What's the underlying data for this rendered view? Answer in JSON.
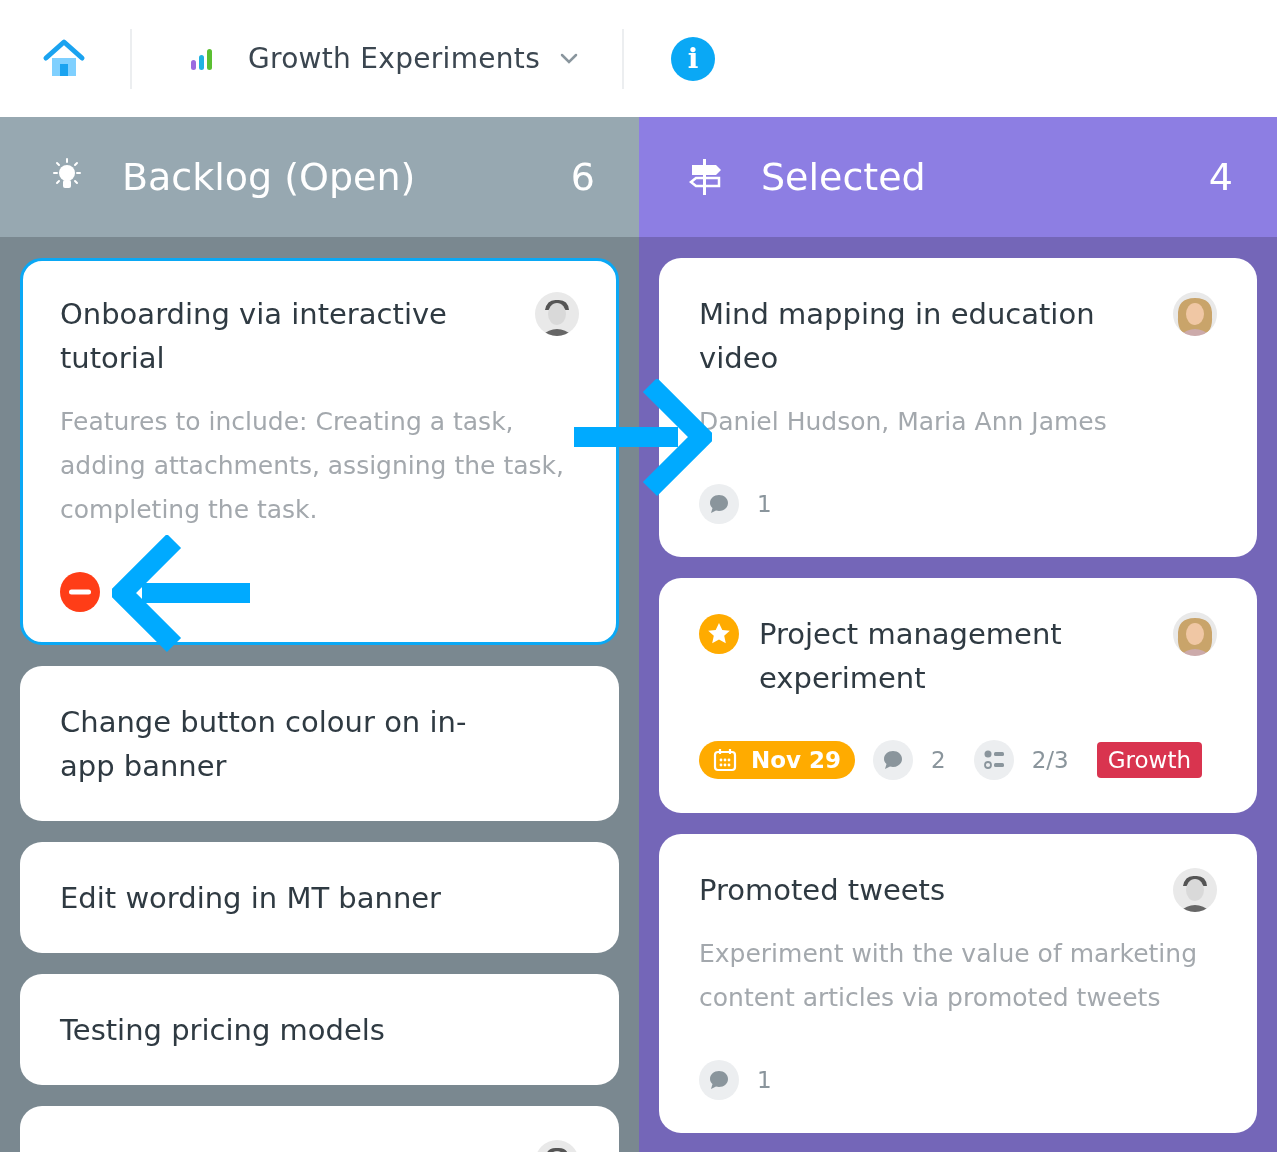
{
  "header": {
    "project": "Growth Experiments",
    "info": "i"
  },
  "columns": [
    {
      "title": "Backlog (Open)",
      "count": "6",
      "kind": "backlog",
      "cards": [
        {
          "title": "Onboarding via interactive tutorial",
          "selected": true,
          "avatar": {
            "kind": "man"
          },
          "description": "Features to include: Creating a task, adding attachments, assigning the task, completing the task.",
          "blocked": true
        },
        {
          "title": "Change button colour on in-app banner",
          "selected": false
        },
        {
          "title": "Edit wording in MT banner",
          "selected": false
        },
        {
          "title": "Testing pricing models",
          "selected": false
        },
        {
          "selected": false,
          "avatar": {
            "kind": "man"
          }
        }
      ]
    },
    {
      "title": "Selected",
      "count": "4",
      "kind": "selected",
      "cards": [
        {
          "title": "Mind mapping in education video",
          "selected": false,
          "avatar": {
            "kind": "woman"
          },
          "description": "Daniel Hudson, Maria Ann James",
          "comments": "1"
        },
        {
          "title": "Project management experiment",
          "selected": false,
          "avatar": {
            "kind": "woman"
          },
          "starred": true,
          "due": "Nov 29",
          "comments": "2",
          "checklist": "2/3",
          "tag": {
            "label": "Growth",
            "color": "#d9344f"
          }
        },
        {
          "title": "Promoted tweets",
          "selected": false,
          "avatar": {
            "kind": "man"
          },
          "description": "Experiment with the value of marketing content articles via promoted tweets",
          "comments": "1"
        }
      ]
    }
  ],
  "annotations": [
    {
      "kind": "rightward"
    },
    {
      "kind": "leftward"
    }
  ]
}
